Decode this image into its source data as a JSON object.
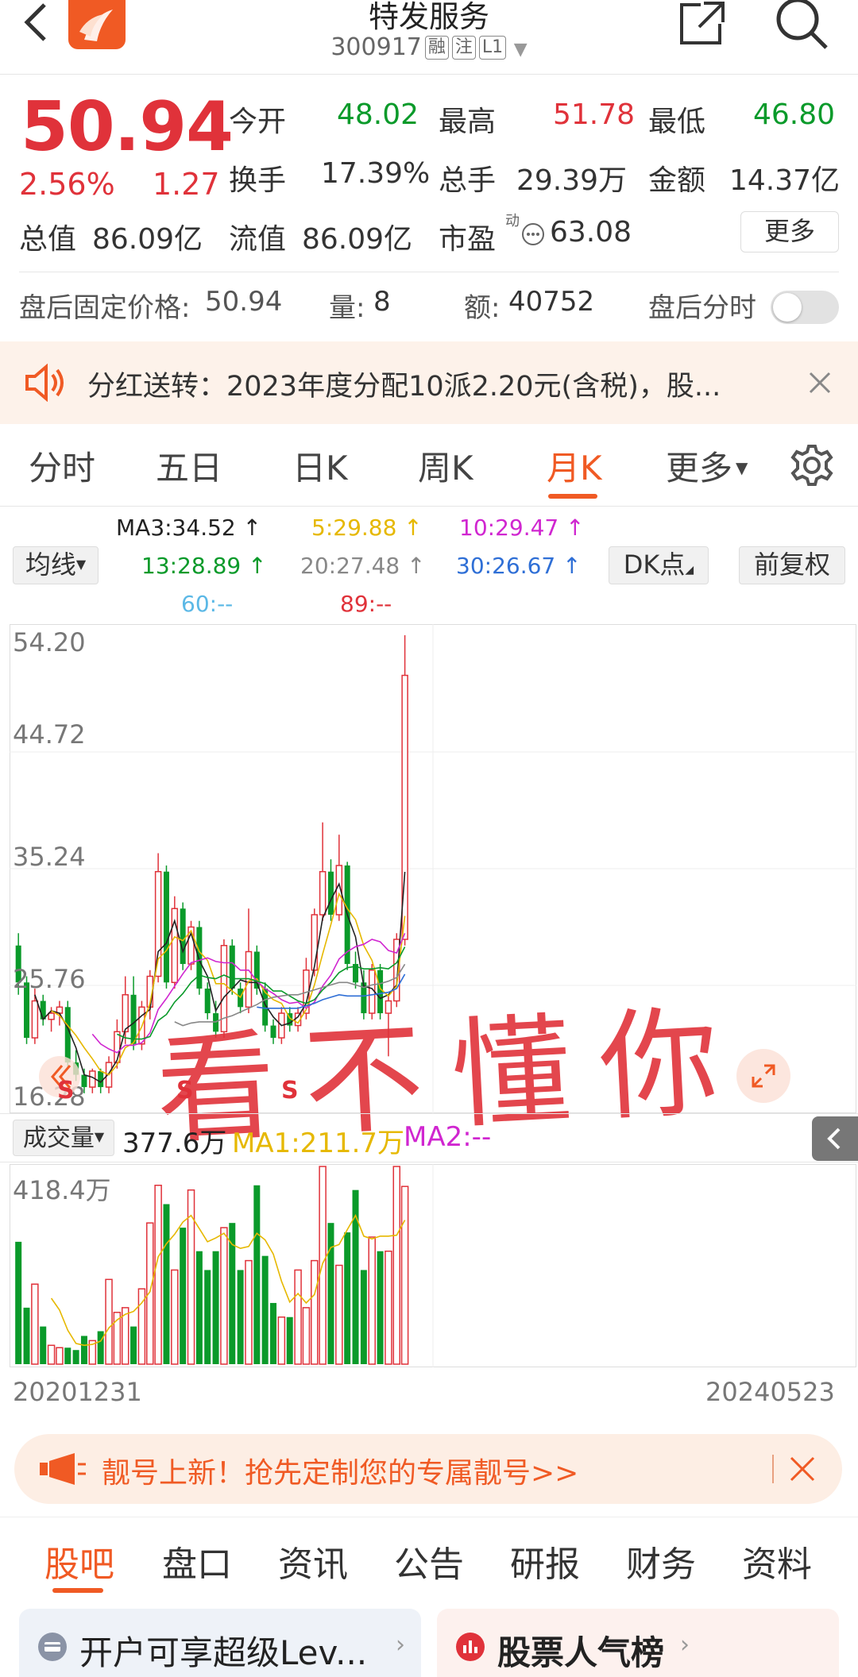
{
  "header": {
    "title": "特发服务",
    "code": "300917",
    "tag_margin": "融",
    "tag_follow": "注",
    "tag_level": "L1"
  },
  "quote": {
    "price": "50.94",
    "change_pct": "2.56%",
    "change": "1.27",
    "open_label": "今开",
    "open": "48.02",
    "high_label": "最高",
    "high": "51.78",
    "low_label": "最低",
    "low": "46.80",
    "turnover_label": "换手",
    "turnover": "17.39%",
    "volume_label": "总手",
    "volume": "29.39万",
    "amount_label": "金额",
    "amount": "14.37亿",
    "mktcap_label": "总值",
    "mktcap": "86.09亿",
    "float_label": "流值",
    "float_cap": "86.09亿",
    "pe_label": "市盈",
    "pe_sup": "动",
    "pe": "63.08",
    "more": "更多"
  },
  "after_hours": {
    "price_label": "盘后固定价格:",
    "price": "50.94",
    "vol_label": "量:",
    "vol": "8",
    "amt_label": "额:",
    "amt": "40752",
    "timeshare_label": "盘后分时",
    "timeshare_on": false
  },
  "notice": {
    "text": "分红送转：2023年度分配10派2.20元(含税)，股..."
  },
  "period_tabs": [
    "分时",
    "五日",
    "日K",
    "周K",
    "月K",
    "更多"
  ],
  "active_period": "月K",
  "ma_legend": {
    "selector": "均线",
    "ma3": "MA3:34.52",
    "ma5": "5:29.88",
    "ma10": "10:29.47",
    "ma13": "13:28.89",
    "ma20": "20:27.48",
    "ma30": "30:26.67",
    "ma60": "60:--",
    "ma89": "89:--",
    "dk": "DK点",
    "adjust": "前复权"
  },
  "price_axis": {
    "ticks": [
      "54.20",
      "44.72",
      "35.24",
      "25.76",
      "16.28"
    ]
  },
  "volume_legend": {
    "selector": "成交量",
    "value": "377.6万",
    "ma1": "MA1:211.7万",
    "ma2": "MA2:--",
    "max_label": "418.4万"
  },
  "date_axis": {
    "start": "20201231",
    "end": "20240523"
  },
  "watermark": "看不懂你",
  "banner": {
    "text": "靓号上新！抢先定制您的专属靓号>>"
  },
  "bottom_tabs": [
    "股吧",
    "盘口",
    "资讯",
    "公告",
    "研报",
    "财务",
    "资料"
  ],
  "active_bottom_tab": "股吧",
  "cards": [
    {
      "text": "开户可享超级Lev..."
    },
    {
      "text": "股票人气榜"
    }
  ],
  "colors": {
    "up": "#e0323a",
    "down": "#0a9a2a",
    "accent": "#f05a24"
  },
  "chart_data": {
    "type": "candlestick",
    "period": "monthly",
    "ylim": [
      16.28,
      54.2
    ],
    "y_ticks": [
      54.2,
      44.72,
      35.24,
      25.76,
      16.28
    ],
    "x_start": "20201231",
    "x_end": "20240523",
    "candles": [
      [
        29.0,
        30.0,
        25.0,
        26.0
      ],
      [
        26.0,
        26.5,
        21.0,
        21.5
      ],
      [
        21.5,
        25.5,
        21.0,
        24.5
      ],
      [
        24.5,
        25.0,
        22.5,
        23.0
      ],
      [
        23.0,
        24.0,
        22.0,
        23.5
      ],
      [
        23.5,
        24.5,
        22.5,
        24.0
      ],
      [
        24.0,
        24.5,
        19.0,
        19.5
      ],
      [
        19.5,
        20.5,
        18.0,
        18.5
      ],
      [
        18.5,
        19.0,
        17.0,
        17.5
      ],
      [
        17.5,
        19.0,
        17.0,
        18.8
      ],
      [
        18.8,
        19.0,
        17.0,
        17.5
      ],
      [
        17.5,
        20.0,
        17.0,
        19.5
      ],
      [
        19.5,
        23.0,
        19.0,
        22.0
      ],
      [
        22.0,
        26.5,
        21.0,
        25.0
      ],
      [
        25.0,
        26.5,
        20.5,
        21.0
      ],
      [
        21.0,
        24.5,
        20.5,
        24.0
      ],
      [
        24.0,
        27.0,
        23.0,
        26.5
      ],
      [
        26.5,
        36.5,
        26.0,
        35.0
      ],
      [
        35.0,
        35.5,
        25.5,
        26.0
      ],
      [
        26.0,
        33.0,
        25.5,
        32.0
      ],
      [
        32.0,
        32.5,
        27.0,
        27.5
      ],
      [
        27.5,
        31.0,
        27.0,
        30.5
      ],
      [
        30.5,
        31.0,
        25.0,
        25.5
      ],
      [
        25.5,
        26.0,
        23.0,
        23.5
      ],
      [
        23.5,
        24.5,
        21.5,
        22.0
      ],
      [
        22.0,
        29.5,
        21.5,
        29.0
      ],
      [
        29.0,
        29.5,
        25.0,
        25.5
      ],
      [
        25.5,
        26.0,
        23.5,
        24.0
      ],
      [
        24.0,
        32.0,
        23.5,
        28.5
      ],
      [
        28.5,
        29.0,
        25.0,
        25.5
      ],
      [
        25.5,
        26.0,
        22.0,
        22.5
      ],
      [
        22.5,
        23.0,
        21.0,
        21.5
      ],
      [
        21.5,
        24.0,
        21.0,
        23.5
      ],
      [
        23.5,
        24.0,
        22.0,
        22.5
      ],
      [
        22.5,
        24.0,
        22.0,
        23.5
      ],
      [
        23.5,
        28.0,
        23.0,
        27.0
      ],
      [
        27.0,
        32.0,
        26.5,
        31.5
      ],
      [
        31.5,
        39.0,
        31.0,
        35.0
      ],
      [
        35.0,
        36.0,
        31.0,
        31.5
      ],
      [
        31.5,
        38.0,
        31.0,
        35.5
      ],
      [
        35.5,
        35.8,
        27.0,
        27.5
      ],
      [
        27.5,
        28.5,
        25.5,
        26.0
      ],
      [
        26.0,
        27.0,
        23.0,
        23.5
      ],
      [
        23.5,
        27.5,
        23.0,
        27.0
      ],
      [
        27.0,
        27.5,
        23.0,
        23.5
      ],
      [
        23.5,
        25.0,
        20.0,
        24.5
      ],
      [
        24.5,
        30.0,
        24.0,
        29.5
      ],
      [
        29.5,
        54.2,
        29.0,
        50.94
      ]
    ],
    "ma": [
      {
        "name": "MA3",
        "color": "#222222",
        "values": [
          null,
          null,
          25.0,
          23.0,
          23.7,
          23.5,
          22.3,
          20.7,
          18.5,
          18.3,
          17.9,
          18.6,
          19.7,
          22.2,
          22.7,
          23.3,
          23.8,
          28.5,
          29.2,
          31.0,
          28.5,
          30.0,
          27.8,
          26.5,
          23.7,
          24.8,
          25.5,
          26.2,
          26.0,
          26.0,
          24.2,
          23.2,
          22.5,
          22.7,
          23.2,
          24.3,
          27.3,
          31.2,
          32.7,
          34.0,
          31.5,
          29.7,
          25.7,
          25.5,
          24.7,
          25.0,
          25.8,
          34.98
        ]
      },
      {
        "name": "MA5",
        "color": "#e6b800",
        "values": [
          null,
          null,
          null,
          null,
          23.7,
          23.3,
          22.5,
          21.7,
          20.7,
          19.8,
          18.8,
          18.5,
          19.3,
          20.7,
          21.1,
          22.4,
          24.3,
          27.9,
          28.6,
          29.7,
          29.4,
          30.2,
          28.5,
          27.8,
          25.9,
          25.9,
          25.3,
          24.8,
          26.1,
          26.3,
          25.2,
          24.6,
          24.3,
          23.1,
          22.7,
          23.8,
          25.8,
          28.3,
          30.7,
          33.2,
          32.0,
          31.1,
          29.0,
          27.8,
          25.5,
          24.9,
          25.7,
          31.4
        ]
      },
      {
        "name": "MA10",
        "color": "#d026d0",
        "values": [
          null,
          null,
          null,
          null,
          null,
          null,
          null,
          null,
          null,
          21.8,
          21.0,
          20.6,
          20.3,
          20.9,
          20.9,
          21.1,
          21.9,
          23.8,
          24.7,
          25.7,
          26.7,
          27.6,
          27.8,
          28.0,
          27.7,
          27.6,
          27.6,
          27.0,
          27.0,
          26.1,
          25.5,
          25.1,
          24.6,
          24.3,
          24.4,
          23.9,
          24.4,
          25.7,
          26.6,
          27.9,
          28.5,
          28.9,
          29.1,
          29.5,
          29.3,
          28.6,
          28.4,
          30.0
        ]
      },
      {
        "name": "MA13",
        "color": "#0a9a2a",
        "values": [
          null,
          null,
          null,
          null,
          null,
          null,
          null,
          null,
          null,
          null,
          null,
          null,
          21.8,
          21.5,
          21.4,
          21.4,
          21.6,
          22.9,
          23.4,
          24.4,
          25.1,
          26.0,
          26.6,
          26.4,
          26.3,
          26.6,
          26.3,
          26.3,
          26.3,
          26.1,
          25.9,
          25.3,
          25.3,
          24.9,
          24.5,
          24.3,
          24.6,
          25.4,
          26.0,
          26.8,
          27.2,
          27.3,
          27.1,
          27.1,
          27.2,
          27.1,
          27.6,
          28.89
        ]
      },
      {
        "name": "MA20",
        "color": "#888888",
        "values": [
          null,
          null,
          null,
          null,
          null,
          null,
          null,
          null,
          null,
          null,
          null,
          null,
          null,
          null,
          null,
          null,
          null,
          null,
          null,
          22.8,
          22.5,
          22.7,
          22.8,
          22.8,
          22.8,
          23.1,
          23.3,
          23.6,
          23.9,
          24.2,
          24.6,
          24.8,
          24.9,
          25.0,
          25.0,
          25.2,
          25.4,
          25.6,
          25.8,
          26.0,
          26.0,
          25.8,
          25.6,
          25.8,
          25.9,
          26.1,
          26.4,
          27.48
        ]
      },
      {
        "name": "MA30",
        "color": "#2f6fd6",
        "values": [
          null,
          null,
          null,
          null,
          null,
          null,
          null,
          null,
          null,
          null,
          null,
          null,
          null,
          null,
          null,
          null,
          null,
          null,
          null,
          null,
          null,
          null,
          null,
          null,
          null,
          null,
          null,
          null,
          null,
          24.0,
          23.9,
          23.9,
          23.9,
          23.9,
          23.9,
          24.1,
          24.3,
          24.6,
          24.8,
          25.0,
          24.9,
          24.9,
          24.9,
          25.0,
          25.1,
          25.2,
          25.5,
          26.67
        ]
      }
    ],
    "volume": {
      "ylim": [
        0,
        418.4
      ],
      "unit": "万",
      "values": [
        260,
        120,
        170,
        80,
        40,
        35,
        35,
        30,
        60,
        50,
        70,
        180,
        110,
        120,
        80,
        160,
        300,
        380,
        340,
        200,
        290,
        370,
        240,
        200,
        240,
        290,
        300,
        200,
        220,
        380,
        230,
        130,
        100,
        100,
        200,
        120,
        220,
        420,
        300,
        210,
        280,
        370,
        200,
        270,
        240,
        240,
        420,
        377.6
      ],
      "ma1": [
        null,
        null,
        null,
        null,
        140,
        115,
        72,
        44,
        40,
        42,
        49,
        77,
        94,
        106,
        112,
        130,
        154,
        228,
        256,
        276,
        302,
        316,
        288,
        260,
        268,
        278,
        254,
        246,
        250,
        278,
        264,
        234,
        176,
        132,
        150,
        130,
        148,
        214,
        248,
        254,
        286,
        316,
        272,
        266,
        272,
        272,
        274,
        306
      ]
    }
  }
}
